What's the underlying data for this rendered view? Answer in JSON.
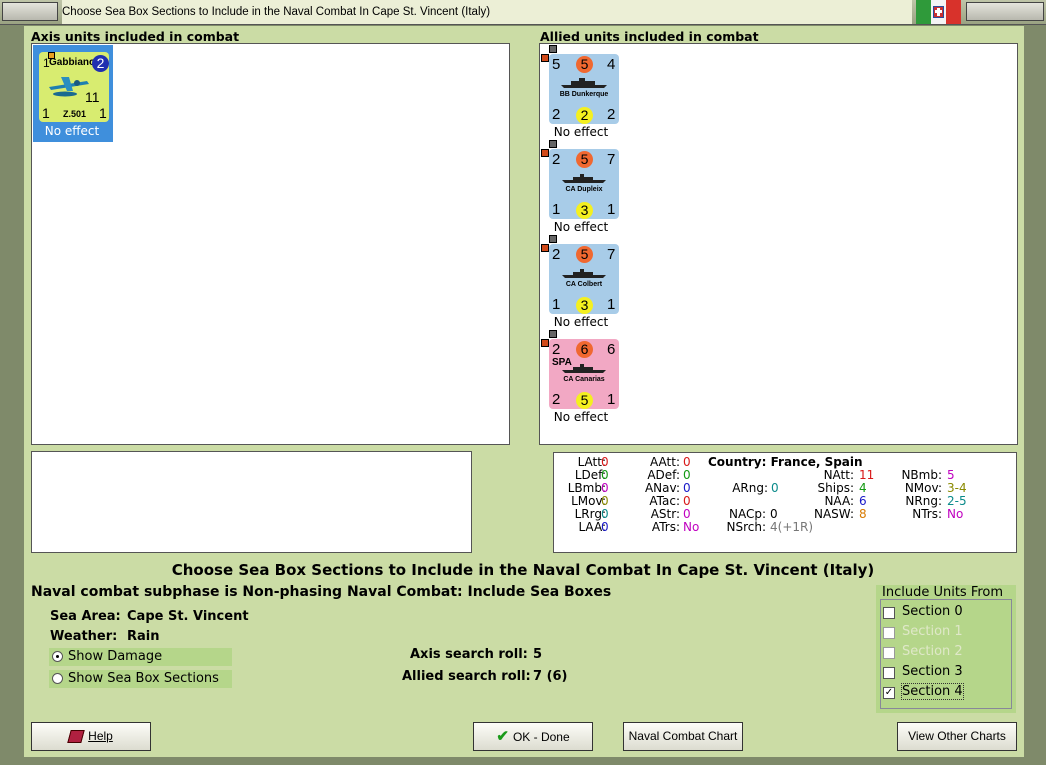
{
  "window": {
    "title": "Choose Sea Box Sections to Include in the Naval Combat In Cape St. Vincent (Italy)"
  },
  "axis_panel": {
    "heading": "Axis units included in combat",
    "units": [
      {
        "name": "Gabbiano",
        "badge": "2",
        "top_left": "1",
        "strength": "11",
        "bottom_left": "1",
        "bottom_right": "1",
        "type": "Z.501",
        "effect": "No effect",
        "color": "#d8ec70"
      }
    ]
  },
  "allied_panel": {
    "heading": "Allied units included in combat",
    "units": [
      {
        "name": "BB Dunkerque",
        "tl": "5",
        "mid": "5",
        "tr": "4",
        "bl": "2",
        "bm": "2",
        "br": "2",
        "effect": "No effect",
        "color": "#a8cce8",
        "nation": ""
      },
      {
        "name": "CA Dupleix",
        "tl": "2",
        "mid": "5",
        "tr": "7",
        "bl": "1",
        "bm": "3",
        "br": "1",
        "effect": "No effect",
        "color": "#a8cce8",
        "nation": ""
      },
      {
        "name": "CA Colbert",
        "tl": "2",
        "mid": "5",
        "tr": "7",
        "bl": "1",
        "bm": "3",
        "br": "1",
        "effect": "No effect",
        "color": "#a8cce8",
        "nation": ""
      },
      {
        "name": "CA Canarias",
        "tl": "2",
        "mid": "6",
        "tr": "6",
        "bl": "2",
        "bm": "5",
        "br": "1",
        "effect": "No effect",
        "color": "#f2a8c4",
        "nation": "SPA"
      }
    ]
  },
  "stats": {
    "country": "Country: France, Spain",
    "col1": [
      {
        "k": "LAtt:",
        "v": "0",
        "c": "red"
      },
      {
        "k": "LDef:",
        "v": "0",
        "c": "green"
      },
      {
        "k": "LBmb:",
        "v": "0",
        "c": "magenta"
      },
      {
        "k": "LMov:",
        "v": "0",
        "c": "olive"
      },
      {
        "k": "LRrg:",
        "v": "0",
        "c": "teal"
      },
      {
        "k": "LAA:",
        "v": "0",
        "c": "blue"
      }
    ],
    "col2": [
      {
        "k": "AAtt:",
        "v": "0",
        "c": "red"
      },
      {
        "k": "ADef:",
        "v": "0",
        "c": "green"
      },
      {
        "k": "ANav:",
        "v": "0",
        "c": "blue"
      },
      {
        "k": "ATac:",
        "v": "0",
        "c": "red"
      },
      {
        "k": "AStr:",
        "v": "0",
        "c": "magenta"
      },
      {
        "k": "ATrs:",
        "v": "No",
        "c": "magenta"
      }
    ],
    "arng": {
      "k": "ARng:",
      "v": "0",
      "c": "teal"
    },
    "nacp": {
      "k": "NACp:",
      "v": "0",
      "c": ""
    },
    "nsrch": {
      "k": "NSrch:",
      "v": "4(+1R)",
      "c": "grey"
    },
    "col4": [
      {
        "k": "NAtt:",
        "v": "11",
        "c": "red"
      },
      {
        "k": "Ships:",
        "v": "4",
        "c": "green"
      },
      {
        "k": "NAA:",
        "v": "6",
        "c": "blue"
      },
      {
        "k": "NASW:",
        "v": "8",
        "c": "orange"
      }
    ],
    "col5": [
      {
        "k": "NBmb:",
        "v": "5",
        "c": "magenta"
      },
      {
        "k": "NMov:",
        "v": "3-4",
        "c": "olive"
      },
      {
        "k": "NRng:",
        "v": "2-5",
        "c": "teal"
      },
      {
        "k": "NTrs:",
        "v": "No",
        "c": "magenta"
      }
    ]
  },
  "main": {
    "heading": "Choose Sea Box Sections to Include in the Naval Combat In Cape St. Vincent (Italy)",
    "subphase": "Naval combat subphase is Non-phasing Naval Combat: Include Sea Boxes",
    "sea_area_label": "Sea Area:",
    "sea_area": "Cape St. Vincent",
    "weather_label": "Weather:",
    "weather": "Rain",
    "show_damage": "Show Damage",
    "show_sections": "Show Sea Box Sections",
    "axis_roll_label": "Axis search roll:",
    "axis_roll": "5",
    "allied_roll_label": "Allied search roll:",
    "allied_roll": "7 (6)"
  },
  "include": {
    "title": "Include Units From",
    "sections": [
      {
        "label": "Section 0",
        "checked": false,
        "enabled": true
      },
      {
        "label": "Section 1",
        "checked": false,
        "enabled": false
      },
      {
        "label": "Section 2",
        "checked": false,
        "enabled": false
      },
      {
        "label": "Section 3",
        "checked": false,
        "enabled": true
      },
      {
        "label": "Section 4",
        "checked": true,
        "enabled": true
      }
    ]
  },
  "buttons": {
    "help": "Help",
    "ok": "OK - Done",
    "chart": "Naval Combat Chart",
    "other": "View Other Charts"
  }
}
